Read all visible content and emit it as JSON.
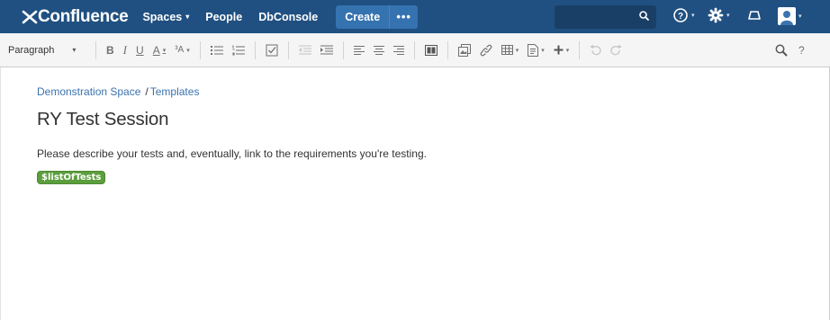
{
  "header": {
    "logo_text": "Confluence",
    "nav": [
      {
        "label": "Spaces",
        "has_caret": true
      },
      {
        "label": "People",
        "has_caret": false
      },
      {
        "label": "DbConsole",
        "has_caret": false
      }
    ],
    "create_label": "Create",
    "more_label": "•••",
    "search_placeholder": "",
    "icons": [
      "search-icon",
      "help-icon",
      "settings-icon",
      "notifications-icon",
      "user-avatar-icon"
    ],
    "accent": "#205081"
  },
  "toolbar": {
    "paragraph_label": "Paragraph",
    "buttons": {
      "bold": "B",
      "italic": "I",
      "underline": "U",
      "text_color": "A",
      "more_formatting": "³A",
      "help": "?"
    }
  },
  "content": {
    "breadcrumb": [
      {
        "label": "Demonstration Space"
      },
      {
        "label": "Templates"
      }
    ],
    "breadcrumb_separator": "/",
    "title": "RY Test Session",
    "body": "Please describe your tests and, eventually, link to the requirements you're testing.",
    "placeholder_variable": "$listOfTests",
    "placeholder_color": "#5c9e3e"
  }
}
